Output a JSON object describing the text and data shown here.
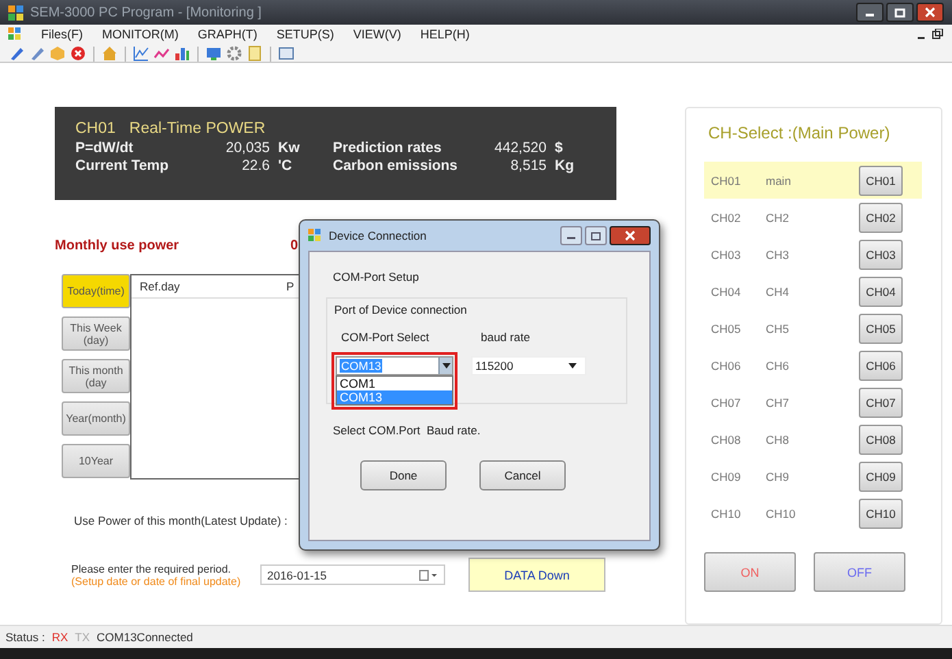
{
  "window": {
    "title": "SEM-3000 PC Program - [Monitoring ]"
  },
  "menu": [
    "Files(F)",
    "MONITOR(M)",
    "GRAPH(T)",
    "SETUP(S)",
    "VIEW(V)",
    "HELP(H)"
  ],
  "realtime": {
    "channel": "CH01",
    "title": "Real-Time POWER",
    "left": [
      {
        "label": "P=dW/dt",
        "value": "20,035",
        "unit": "Kw"
      },
      {
        "label": "Current Temp",
        "value": "22.6",
        "unit": "'C"
      }
    ],
    "right": [
      {
        "label": "Prediction rates",
        "value": "442,520",
        "unit": "$"
      },
      {
        "label": "Carbon emissions",
        "value": "8,515",
        "unit": "Kg"
      }
    ]
  },
  "monthly": {
    "label": "Monthly use power",
    "value": "0"
  },
  "periods": [
    {
      "label": "Today(time)",
      "selected": true
    },
    {
      "label": "This Week(day)",
      "selected": false
    },
    {
      "label": "This month(day",
      "selected": false
    },
    {
      "label": "Year(month)",
      "selected": false
    },
    {
      "label": "10Year",
      "selected": false
    }
  ],
  "table": {
    "columns": [
      "Ref.day",
      "P"
    ]
  },
  "use_power": "Use Power of this month(Latest Update) :",
  "period": {
    "prompt": "Please enter the required period.",
    "hint": "(Setup date or date of final update)",
    "date": "2016-01-15"
  },
  "data_down": "DATA Down",
  "ch_select": {
    "title": "CH-Select :(Main Power)",
    "channels": [
      {
        "id": "CH01",
        "name": "main",
        "button": "CH01",
        "selected": true
      },
      {
        "id": "CH02",
        "name": "CH2",
        "button": "CH02",
        "selected": false
      },
      {
        "id": "CH03",
        "name": "CH3",
        "button": "CH03",
        "selected": false
      },
      {
        "id": "CH04",
        "name": "CH4",
        "button": "CH04",
        "selected": false
      },
      {
        "id": "CH05",
        "name": "CH5",
        "button": "CH05",
        "selected": false
      },
      {
        "id": "CH06",
        "name": "CH6",
        "button": "CH06",
        "selected": false
      },
      {
        "id": "CH07",
        "name": "CH7",
        "button": "CH07",
        "selected": false
      },
      {
        "id": "CH08",
        "name": "CH8",
        "button": "CH08",
        "selected": false
      },
      {
        "id": "CH09",
        "name": "CH9",
        "button": "CH09",
        "selected": false
      },
      {
        "id": "CH10",
        "name": "CH10",
        "button": "CH10",
        "selected": false
      }
    ],
    "on": "ON",
    "off": "OFF"
  },
  "status": {
    "label": "Status :",
    "indicators": [
      {
        "text": "RX",
        "active": true
      },
      {
        "text": "TX",
        "active": false
      }
    ],
    "message": "COM13Connected"
  },
  "dialog": {
    "title": "Device Connection",
    "heading": "COM-Port Setup",
    "group": "Port of Device connection",
    "port_label": "COM-Port Select",
    "baud_label": "baud rate",
    "port_value": "COM13",
    "port_options": [
      {
        "label": "COM1",
        "selected": false
      },
      {
        "label": "COM13",
        "selected": true
      }
    ],
    "baud_value": "115200",
    "hint": "Select COM.Port  Baud rate.",
    "buttons": [
      "Done",
      "Cancel"
    ]
  }
}
